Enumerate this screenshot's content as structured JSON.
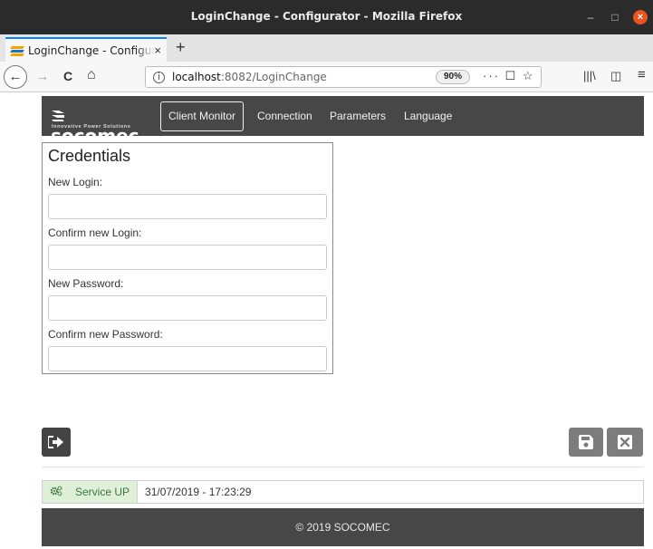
{
  "window": {
    "title": "LoginChange - Configurator - Mozilla Firefox",
    "min_glyph": "–",
    "max_glyph": "□",
    "close_glyph": "×"
  },
  "browser": {
    "tab_title": "LoginChange - Configurator",
    "tab_close": "×",
    "new_tab": "+",
    "url_host": "localhost",
    "url_path": ":8082/LoginChange",
    "zoom": "90%",
    "info_glyph": "i",
    "back_glyph": "←",
    "forward_glyph": "→",
    "reload_glyph": "C",
    "home_glyph": "⌂",
    "page_actions": "··· ☐ ☆",
    "library_glyph": "|||\\",
    "sidebar_glyph": "◫",
    "menu_glyph": "≡"
  },
  "brand": {
    "logo_text": "socomec",
    "tagline": "Innovative Power Solutions"
  },
  "nav": {
    "items": [
      {
        "label": "Client Monitor"
      },
      {
        "label": "Connection"
      },
      {
        "label": "Parameters"
      },
      {
        "label": "Language"
      }
    ]
  },
  "credentials": {
    "title": "Credentials",
    "fields": [
      {
        "label": "New Login:",
        "value": ""
      },
      {
        "label": "Confirm new Login:",
        "value": ""
      },
      {
        "label": "New Password:",
        "value": ""
      },
      {
        "label": "Confirm new Password:",
        "value": ""
      }
    ]
  },
  "status": {
    "text": "Service UP",
    "timestamp": "31/07/2019 - 17:23:29"
  },
  "footer": {
    "text": "© 2019 SOCOMEC"
  },
  "colors": {
    "header_bg": "#474747",
    "status_bg": "#dff0d8",
    "status_text": "#3c763d",
    "button_gray": "#7d7d7d",
    "button_dark": "#444444"
  }
}
